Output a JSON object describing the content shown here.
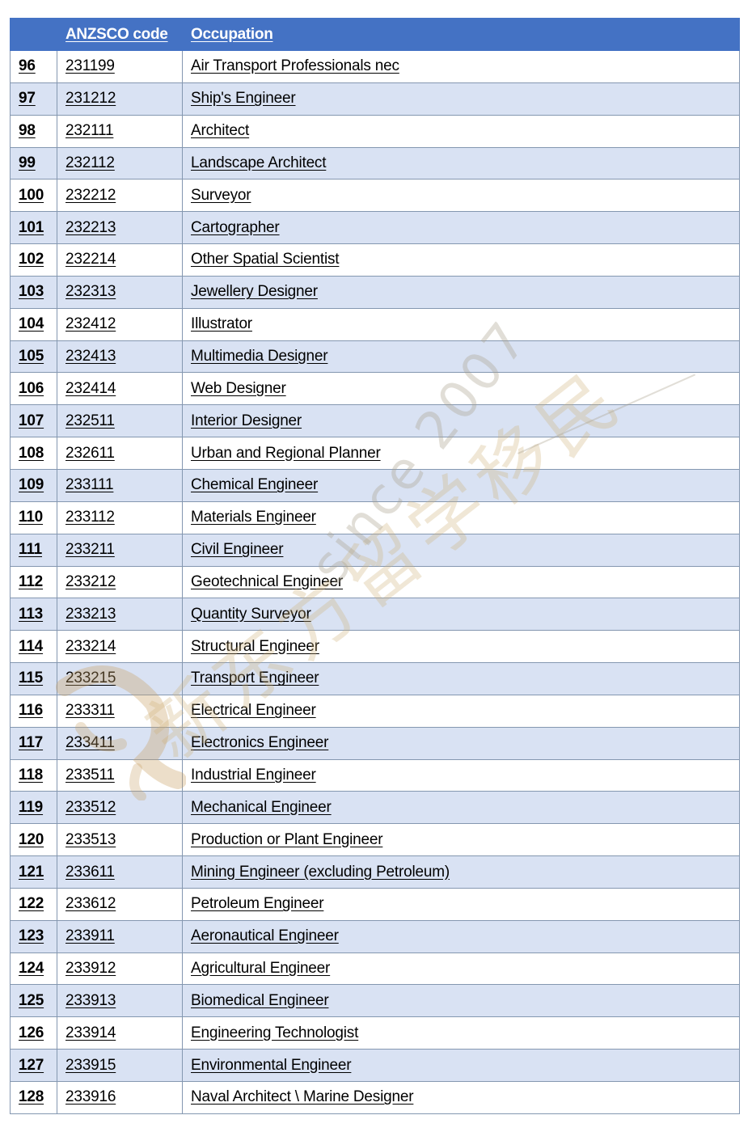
{
  "table": {
    "headers": {
      "number": "",
      "code": "ANZSCO code",
      "occupation": "Occupation"
    },
    "rows": [
      {
        "num": "96",
        "code": "231199",
        "occupation": "Air Transport Professionals nec"
      },
      {
        "num": "97",
        "code": "231212",
        "occupation": "Ship's Engineer"
      },
      {
        "num": "98",
        "code": "232111",
        "occupation": "Architect"
      },
      {
        "num": "99",
        "code": "232112",
        "occupation": "Landscape Architect"
      },
      {
        "num": "100",
        "code": "232212",
        "occupation": "Surveyor"
      },
      {
        "num": "101",
        "code": "232213",
        "occupation": "Cartographer"
      },
      {
        "num": "102",
        "code": "232214",
        "occupation": "Other Spatial Scientist"
      },
      {
        "num": "103",
        "code": "232313",
        "occupation": "Jewellery Designer"
      },
      {
        "num": "104",
        "code": "232412",
        "occupation": "Illustrator"
      },
      {
        "num": "105",
        "code": "232413",
        "occupation": "Multimedia Designer"
      },
      {
        "num": "106",
        "code": "232414",
        "occupation": "Web Designer"
      },
      {
        "num": "107",
        "code": "232511",
        "occupation": "Interior Designer"
      },
      {
        "num": "108",
        "code": "232611",
        "occupation": "Urban and Regional Planner"
      },
      {
        "num": "109",
        "code": "233111",
        "occupation": "Chemical Engineer"
      },
      {
        "num": "110",
        "code": "233112",
        "occupation": "Materials Engineer"
      },
      {
        "num": "111",
        "code": "233211",
        "occupation": "Civil Engineer"
      },
      {
        "num": "112",
        "code": "233212",
        "occupation": "Geotechnical Engineer"
      },
      {
        "num": "113",
        "code": "233213",
        "occupation": "Quantity Surveyor"
      },
      {
        "num": "114",
        "code": "233214",
        "occupation": "Structural Engineer"
      },
      {
        "num": "115",
        "code": "233215",
        "occupation": "Transport Engineer"
      },
      {
        "num": "116",
        "code": "233311",
        "occupation": "Electrical Engineer"
      },
      {
        "num": "117",
        "code": "233411",
        "occupation": "Electronics Engineer"
      },
      {
        "num": "118",
        "code": "233511",
        "occupation": "Industrial Engineer"
      },
      {
        "num": "119",
        "code": "233512",
        "occupation": "Mechanical Engineer"
      },
      {
        "num": "120",
        "code": "233513",
        "occupation": "Production or Plant Engineer"
      },
      {
        "num": "121",
        "code": "233611",
        "occupation": "Mining Engineer (excluding Petroleum)"
      },
      {
        "num": "122",
        "code": "233612",
        "occupation": "Petroleum Engineer"
      },
      {
        "num": "123",
        "code": "233911",
        "occupation": "Aeronautical Engineer"
      },
      {
        "num": "124",
        "code": "233912",
        "occupation": "Agricultural Engineer"
      },
      {
        "num": "125",
        "code": "233913",
        "occupation": "Biomedical Engineer"
      },
      {
        "num": "126",
        "code": "233914",
        "occupation": "Engineering Technologist"
      },
      {
        "num": "127",
        "code": "233915",
        "occupation": "Environmental Engineer"
      },
      {
        "num": "128",
        "code": "233916",
        "occupation": "Naval Architect \\ Marine Designer"
      }
    ]
  },
  "watermark": {
    "tagline": "since 2007",
    "brand_text": "新东方留学移民"
  },
  "colors": {
    "header_bg": "#4472C4",
    "header_text": "#FFFFFF",
    "row_alt_bg": "#D9E2F3",
    "row_bg": "#FFFFFF",
    "border": "#8497B0"
  }
}
